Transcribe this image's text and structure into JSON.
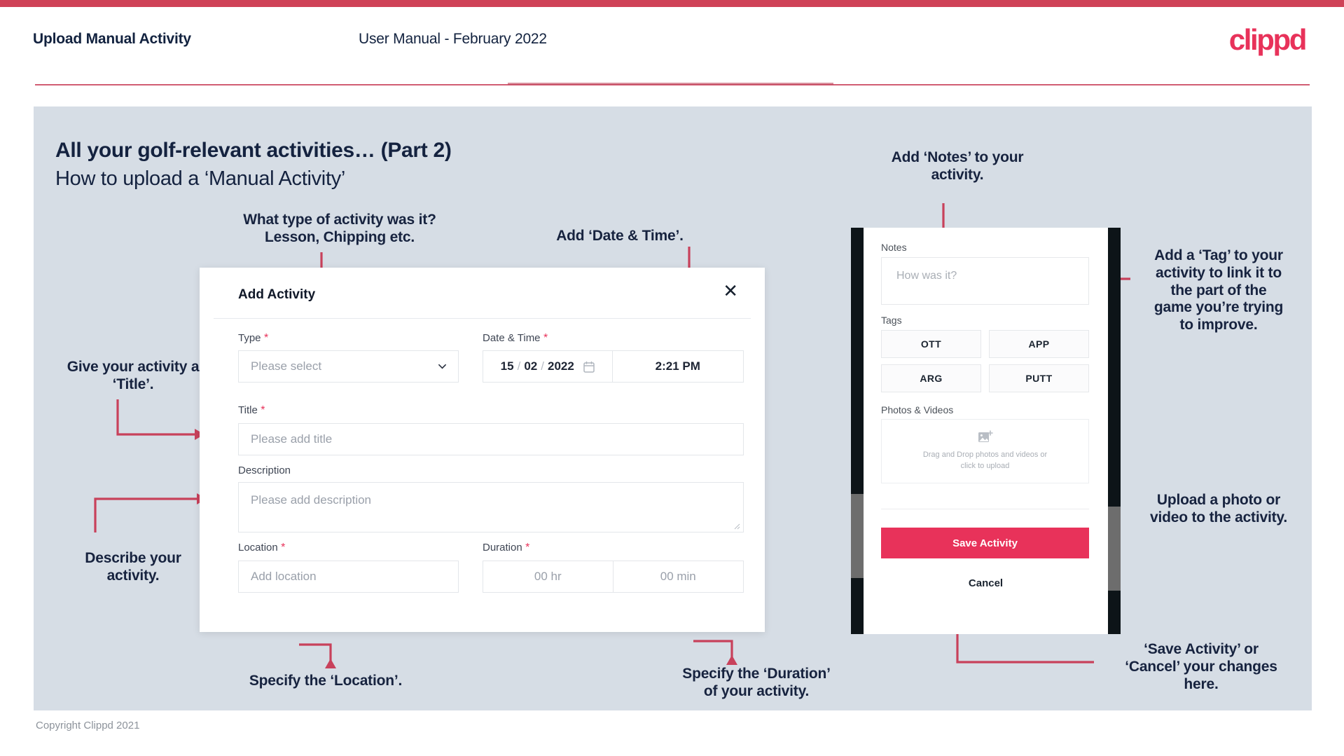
{
  "header": {
    "title": "Upload Manual Activity",
    "subtitle": "User Manual - February 2022",
    "logo": "clippd"
  },
  "slide": {
    "title": "All your golf-relevant activities… (Part 2)",
    "subtitle": "How to upload a ‘Manual Activity’",
    "footer": "Copyright Clippd 2021"
  },
  "colors": {
    "brand_pink": "#e8325a",
    "header_rule": "#cf4257",
    "slide_bg": "#d6dde5",
    "text_navy": "#14223f",
    "annotation_arrow": "#c8415b"
  },
  "dialog": {
    "title": "Add Activity",
    "close_icon": "close-icon",
    "fields": {
      "type": {
        "label": "Type",
        "required": true,
        "placeholder": "Please select",
        "chevron_icon": "chevron-down-icon"
      },
      "datetime": {
        "label": "Date & Time",
        "required": true,
        "day": "15",
        "month": "02",
        "year": "2022",
        "separator": "/",
        "time": "2:21 PM",
        "calendar_icon": "calendar-icon"
      },
      "title": {
        "label": "Title",
        "required": true,
        "placeholder": "Please add title"
      },
      "description": {
        "label": "Description",
        "required": false,
        "placeholder": "Please add description"
      },
      "location": {
        "label": "Location",
        "required": true,
        "placeholder": "Add location"
      },
      "duration": {
        "label": "Duration",
        "required": true,
        "hours": "00 hr",
        "minutes": "00 min"
      }
    }
  },
  "phone": {
    "notes": {
      "label": "Notes",
      "placeholder": "How was it?"
    },
    "tags": {
      "label": "Tags",
      "items": [
        "OTT",
        "APP",
        "ARG",
        "PUTT"
      ]
    },
    "photos": {
      "label": "Photos & Videos",
      "icon": "add-image-icon",
      "drop_line1": "Drag and Drop photos and videos or",
      "drop_line2": "click to upload"
    },
    "save_label": "Save Activity",
    "cancel_label": "Cancel"
  },
  "annotations": {
    "type": "What type of activity was it?\nLesson, Chipping etc.",
    "datetime": "Add ‘Date & Time’.",
    "title": "Give your activity a\n‘Title’.",
    "description": "Describe your\nactivity.",
    "location": "Specify the ‘Location’.",
    "duration": "Specify the ‘Duration’\nof your activity.",
    "notes": "Add ‘Notes’ to your\nactivity.",
    "tags": "Add a ‘Tag’ to your\nactivity to link it to\nthe part of the\ngame you’re trying\nto improve.",
    "photos": "Upload a photo or\nvideo to the activity.",
    "save": "‘Save Activity’ or\n‘Cancel’ your changes\nhere."
  }
}
